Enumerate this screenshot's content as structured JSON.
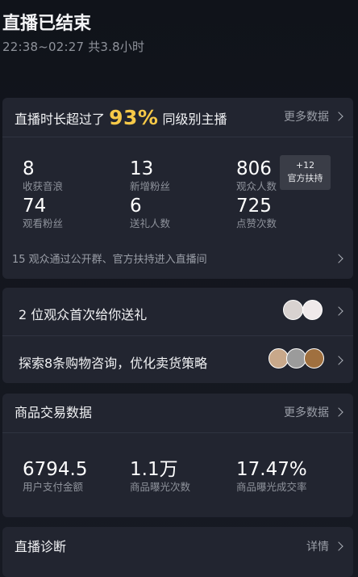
{
  "header": {
    "title": "直播已结束",
    "subtitle": "22:38~02:27 共3.8小时"
  },
  "duration_card": {
    "prefix": "直播时长超过了",
    "percent": "93%",
    "suffix": "同级别主播",
    "more_label": "更多数据",
    "metrics": [
      {
        "value": "8",
        "label": "收获音浪"
      },
      {
        "value": "13",
        "label": "新增粉丝"
      },
      {
        "value": "806",
        "label": "观众人数"
      },
      {
        "value": "74",
        "label": "观看粉丝"
      },
      {
        "value": "6",
        "label": "送礼人数"
      },
      {
        "value": "725",
        "label": "点赞次数"
      }
    ],
    "badge": {
      "line1": "+12",
      "line2": "官方扶持"
    },
    "footer": "15 观众通过公开群、官方扶持进入直播间"
  },
  "gift_card": {
    "rows": [
      {
        "text": "2 位观众首次给你送礼"
      },
      {
        "text": "探索8条购物咨询，优化卖货策略"
      }
    ]
  },
  "trade_card": {
    "title": "商品交易数据",
    "more_label": "更多数据",
    "metrics": [
      {
        "value": "6794.5",
        "label": "用户支付金额"
      },
      {
        "value": "1.1万",
        "label": "商品曝光次数"
      },
      {
        "value": "17.47%",
        "label": "商品曝光成交率"
      }
    ]
  },
  "diagnosis_card": {
    "title": "直播诊断",
    "detail_label": "详情"
  },
  "colors": {
    "background": "#151821",
    "card": "#222530",
    "accent": "#f7c948",
    "secondary_text": "#8e929b"
  }
}
